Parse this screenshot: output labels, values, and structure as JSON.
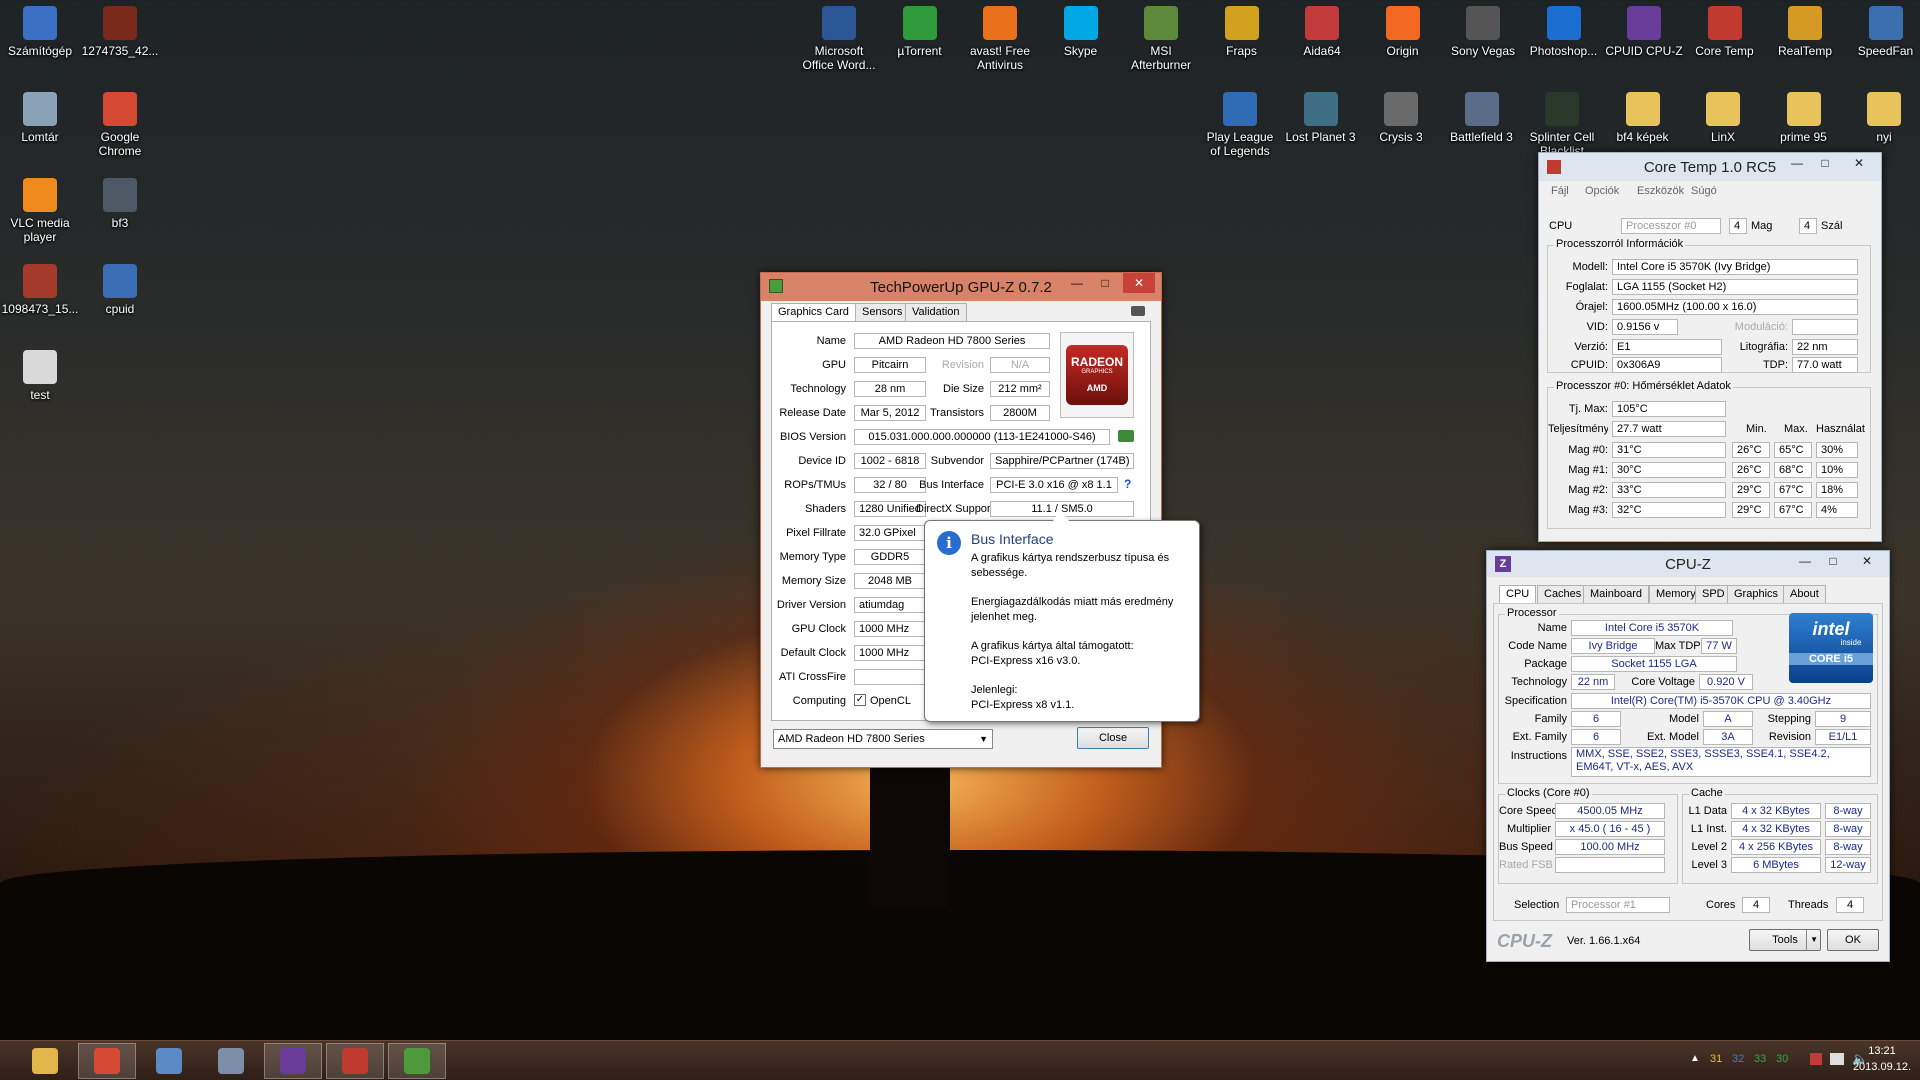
{
  "desktop": {
    "icons_left": [
      {
        "label": "Számítógép",
        "icon": "computer-icon",
        "color": "#3a6fc4"
      },
      {
        "label": "1274735_42...",
        "icon": "image-file-icon",
        "color": "#7a2a1a"
      },
      {
        "label": "Lomtár",
        "icon": "recycle-bin-icon",
        "color": "#8aa2b8"
      },
      {
        "label": "Google Chrome",
        "icon": "chrome-icon",
        "color": "#d64a33"
      },
      {
        "label": "VLC media player",
        "icon": "vlc-icon",
        "color": "#f08a1c"
      },
      {
        "label": "bf3",
        "icon": "image-file-icon",
        "color": "#4d5a66"
      },
      {
        "label": "1098473_15...",
        "icon": "image-file-icon",
        "color": "#a33a2a"
      },
      {
        "label": "cpuid",
        "icon": "folder-icon",
        "color": "#3b6db5"
      },
      {
        "label": "test",
        "icon": "text-file-icon",
        "color": "#d9d9d9"
      }
    ],
    "icons_top": [
      {
        "label": "Microsoft Office Word...",
        "icon": "word-icon",
        "color": "#2b5797"
      },
      {
        "label": "µTorrent",
        "icon": "utorrent-icon",
        "color": "#2e9a3c"
      },
      {
        "label": "avast! Free Antivirus",
        "icon": "avast-icon",
        "color": "#e8701a"
      },
      {
        "label": "Skype",
        "icon": "skype-icon",
        "color": "#00a9e6"
      },
      {
        "label": "MSI Afterburner",
        "icon": "afterburner-icon",
        "color": "#5c8a3a"
      },
      {
        "label": "Fraps",
        "icon": "fraps-icon",
        "color": "#d2a21f"
      },
      {
        "label": "Aida64",
        "icon": "aida64-icon",
        "color": "#c23a3a"
      },
      {
        "label": "Origin",
        "icon": "origin-icon",
        "color": "#f26722"
      },
      {
        "label": "Sony Vegas",
        "icon": "vegas-icon",
        "color": "#555"
      },
      {
        "label": "Photoshop...",
        "icon": "photoshop-icon",
        "color": "#1b6ed0"
      },
      {
        "label": "CPUID CPU-Z",
        "icon": "cpuz-icon",
        "color": "#6a3c9a"
      },
      {
        "label": "Core Temp",
        "icon": "coretemp-icon",
        "color": "#c13a30"
      },
      {
        "label": "RealTemp",
        "icon": "realtemp-icon",
        "color": "#d49a24"
      },
      {
        "label": "SpeedFan",
        "icon": "speedfan-icon",
        "color": "#3c6fb0"
      }
    ],
    "icons_top2": [
      {
        "label": "Play League of Legends",
        "icon": "lol-icon",
        "color": "#2f6cb5"
      },
      {
        "label": "Lost Planet 3",
        "icon": "game-icon",
        "color": "#3e6e84"
      },
      {
        "label": "Crysis 3",
        "icon": "game-icon",
        "color": "#6a6a6a"
      },
      {
        "label": "Battlefield 3",
        "icon": "game-icon",
        "color": "#5a6d88"
      },
      {
        "label": "Splinter Cell Blacklist",
        "icon": "game-icon",
        "color": "#2a3a2a"
      },
      {
        "label": "bf4 képek",
        "icon": "folder-icon",
        "color": "#e8c25a"
      },
      {
        "label": "LinX",
        "icon": "folder-icon",
        "color": "#e8c25a"
      },
      {
        "label": "prime 95",
        "icon": "folder-icon",
        "color": "#e8c25a"
      },
      {
        "label": "nyi",
        "icon": "folder-icon",
        "color": "#e8c25a"
      }
    ]
  },
  "gpuz": {
    "title": "TechPowerUp GPU-Z 0.7.2",
    "tabs": [
      "Graphics Card",
      "Sensors",
      "Validation"
    ],
    "labels": {
      "name": "Name",
      "gpu": "GPU",
      "revision": "Revision",
      "technology": "Technology",
      "die_size": "Die Size",
      "release_date": "Release Date",
      "transistors": "Transistors",
      "bios_version": "BIOS Version",
      "device_id": "Device ID",
      "subvendor": "Subvendor",
      "rops_tmus": "ROPs/TMUs",
      "bus_interface": "Bus Interface",
      "shaders": "Shaders",
      "directx": "DirectX Support",
      "pixel_fillrate": "Pixel Fillrate",
      "memory_type": "Memory Type",
      "memory_size": "Memory Size",
      "driver_version": "Driver Version",
      "gpu_clock": "GPU Clock",
      "default_clock": "Default Clock",
      "crossfire": "ATI CrossFire",
      "computing": "Computing"
    },
    "values": {
      "name": "AMD Radeon HD 7800 Series",
      "gpu": "Pitcairn",
      "revision": "N/A",
      "technology": "28 nm",
      "die_size": "212 mm²",
      "release_date": "Mar 5, 2012",
      "transistors": "2800M",
      "bios_version": "015.031.000.000.000000 (113-1E241000-S46)",
      "device_id": "1002 - 6818",
      "subvendor": "Sapphire/PCPartner (174B)",
      "rops_tmus": "32 / 80",
      "bus_interface": "PCI-E 3.0 x16 @ x8 1.1",
      "shaders": "1280 Unified",
      "directx": "11.1 / SM5.0",
      "pixel_fillrate": "32.0 GPixel",
      "memory_type": "GDDR5",
      "memory_size": "2048 MB",
      "driver_version": "atiumdag",
      "gpu_clock": "1000 MHz",
      "default_clock": "1000 MHz",
      "crossfire": "",
      "opencl": "OpenCL"
    },
    "logo": {
      "line1": "RADEON",
      "line2": "GRAPHICS",
      "line3": "AMD"
    },
    "bus_help": "?",
    "select_value": "AMD Radeon HD 7800 Series",
    "close_label": "Close"
  },
  "tooltip": {
    "title": "Bus Interface",
    "p1": "A grafikus kártya rendszerbusz típusa és sebessége.",
    "p2": "Energiagazdálkodás miatt más eredmény jelenhet meg.",
    "p3a": "A grafikus kártya által támogatott:",
    "p3b": "PCI-Express x16 v3.0.",
    "p4a": "Jelenlegi:",
    "p4b": "PCI-Express x8 v1.1."
  },
  "coretemp": {
    "title": "Core Temp 1.0 RC5",
    "menu": [
      "Fájl",
      "Opciók",
      "Eszközök",
      "Súgó"
    ],
    "cpu_label": "CPU",
    "processor_select": "Processzor #0",
    "cores_val": "4",
    "cores_label": "Mag",
    "threads_val": "4",
    "threads_label": "Szál",
    "info_title": "Processzorról Információk",
    "info": [
      {
        "label": "Modell:",
        "value": "Intel Core i5 3570K (Ivy Bridge)"
      },
      {
        "label": "Foglalat:",
        "value": "LGA 1155 (Socket H2)"
      },
      {
        "label": "Órajel:",
        "value": "1600.05MHz (100.00 x 16.0)"
      }
    ],
    "vid_label": "VID:",
    "vid_value": "0.9156 v",
    "mod_label": "Moduláció:",
    "mod_value": "",
    "ver_label": "Verzió:",
    "ver_value": "E1",
    "lit_label": "Litográfia:",
    "lit_value": "22 nm",
    "cpuid_label": "CPUID:",
    "cpuid_value": "0x306A9",
    "tdp_label": "TDP:",
    "tdp_value": "77.0 watt",
    "temp_title": "Processzor #0: Hőmérséklet Adatok",
    "tjmax_label": "Tj. Max:",
    "tjmax_value": "105°C",
    "power_label": "Teljesítmény:",
    "power_value": "27.7 watt",
    "col_min": "Min.",
    "col_max": "Max.",
    "col_load": "Használat",
    "cores": [
      {
        "label": "Mag #0:",
        "temp": "31°C",
        "min": "26°C",
        "max": "65°C",
        "load": "30%"
      },
      {
        "label": "Mag #1:",
        "temp": "30°C",
        "min": "26°C",
        "max": "68°C",
        "load": "10%"
      },
      {
        "label": "Mag #2:",
        "temp": "33°C",
        "min": "29°C",
        "max": "67°C",
        "load": "18%"
      },
      {
        "label": "Mag #3:",
        "temp": "32°C",
        "min": "29°C",
        "max": "67°C",
        "load": "4%"
      }
    ]
  },
  "cpuz": {
    "title": "CPU-Z",
    "tabs": [
      "CPU",
      "Caches",
      "Mainboard",
      "Memory",
      "SPD",
      "Graphics",
      "About"
    ],
    "processor_group": "Processor",
    "labels": {
      "name": "Name",
      "code_name": "Code Name",
      "max_tdp": "Max TDP",
      "package": "Package",
      "technology": "Technology",
      "core_voltage": "Core Voltage",
      "specification": "Specification",
      "family": "Family",
      "model": "Model",
      "stepping": "Stepping",
      "ext_family": "Ext. Family",
      "ext_model": "Ext. Model",
      "revision": "Revision",
      "instructions": "Instructions"
    },
    "values": {
      "name": "Intel Core i5 3570K",
      "code_name": "Ivy Bridge",
      "max_tdp": "77 W",
      "package": "Socket 1155 LGA",
      "technology": "22 nm",
      "core_voltage": "0.920 V",
      "specification": "Intel(R) Core(TM) i5-3570K CPU @ 3.40GHz",
      "family": "6",
      "model": "A",
      "stepping": "9",
      "ext_family": "6",
      "ext_model": "3A",
      "revision": "E1/L1",
      "instructions": "MMX, SSE, SSE2, SSE3, SSSE3, SSE4.1, SSE4.2, EM64T, VT-x, AES, AVX"
    },
    "intel_logo": {
      "brand": "intel",
      "inside": "inside",
      "core": "CORE i5"
    },
    "clocks_group": "Clocks (Core #0)",
    "clocks": [
      {
        "label": "Core Speed",
        "value": "4500.05 MHz"
      },
      {
        "label": "Multiplier",
        "value": "x 45.0 ( 16 - 45 )"
      },
      {
        "label": "Bus Speed",
        "value": "100.00 MHz"
      },
      {
        "label": "Rated FSB",
        "value": ""
      }
    ],
    "cache_group": "Cache",
    "cache": [
      {
        "label": "L1 Data",
        "size": "4 x 32 KBytes",
        "way": "8-way"
      },
      {
        "label": "L1 Inst.",
        "size": "4 x 32 KBytes",
        "way": "8-way"
      },
      {
        "label": "Level 2",
        "size": "4 x 256 KBytes",
        "way": "8-way"
      },
      {
        "label": "Level 3",
        "size": "6 MBytes",
        "way": "12-way"
      }
    ],
    "selection_label": "Selection",
    "selection_value": "Processor #1",
    "cores_label": "Cores",
    "cores_value": "4",
    "threads_label": "Threads",
    "threads_value": "4",
    "brand": "CPU-Z",
    "version": "Ver. 1.66.1.x64",
    "tools_label": "Tools",
    "ok_label": "OK"
  },
  "taskbar": {
    "items": [
      {
        "icon": "file-explorer-icon",
        "color": "#e2b64a",
        "open": false
      },
      {
        "icon": "chrome-icon",
        "color": "#d64a33",
        "open": true
      },
      {
        "icon": "paint-icon",
        "color": "#5a8bc6",
        "open": false
      },
      {
        "icon": "calculator-icon",
        "color": "#7d8fa8",
        "open": false
      },
      {
        "icon": "cpuz-icon",
        "color": "#6a3c9a",
        "open": true
      },
      {
        "icon": "coretemp-icon",
        "color": "#c13a30",
        "open": true
      },
      {
        "icon": "gpuz-icon",
        "color": "#4c9a3a",
        "open": true
      }
    ],
    "tray_temps": [
      "31",
      "32",
      "33",
      "30"
    ],
    "tray_temp_colors": [
      "#e0c020",
      "#3a7ad8",
      "#2ea84a",
      "#2ea84a"
    ],
    "time": "13:21",
    "date": "2013.09.12."
  }
}
